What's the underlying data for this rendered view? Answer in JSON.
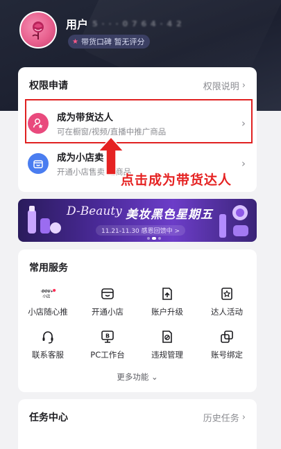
{
  "header": {
    "username": "用户",
    "user_id_masked": "5 · · · 0 7 6 4 · 4 2",
    "badge_text": "带货口碑 暂无评分"
  },
  "permissions": {
    "title": "权限申请",
    "link": "权限说明",
    "items": [
      {
        "title": "成为带货达人",
        "subtitle": "可在橱窗/视频/直播中推广商品"
      },
      {
        "title": "成为小店卖",
        "subtitle": "开通小店售卖   铺商品"
      }
    ]
  },
  "annotation": {
    "text": "点击成为带货达人",
    "color": "#e52222"
  },
  "banner": {
    "brand": "D-Beauty",
    "title": "美妆黑色星期五",
    "subtitle": "11.21-11.30 感恩回馈中 >"
  },
  "services": {
    "title": "常用服务",
    "items": [
      {
        "label": "小店随心推",
        "icon": "dou-plus-icon",
        "icon_text": "DOU+ 小店"
      },
      {
        "label": "开通小店",
        "icon": "shop-icon"
      },
      {
        "label": "账户升级",
        "icon": "upgrade-doc-icon"
      },
      {
        "label": "达人活动",
        "icon": "star-badge-icon"
      },
      {
        "label": "联系客服",
        "icon": "headset-icon"
      },
      {
        "label": "PC工作台",
        "icon": "pc-workbench-icon"
      },
      {
        "label": "违规管理",
        "icon": "violation-doc-icon"
      },
      {
        "label": "账号绑定",
        "icon": "link-accounts-icon"
      }
    ],
    "more": "更多功能"
  },
  "tasks": {
    "title": "任务中心",
    "link": "历史任务"
  },
  "colors": {
    "header_bg": "#1c2030",
    "accent_pink": "#e94a7d",
    "accent_blue": "#4a7df0",
    "highlight_red": "#e02020"
  }
}
